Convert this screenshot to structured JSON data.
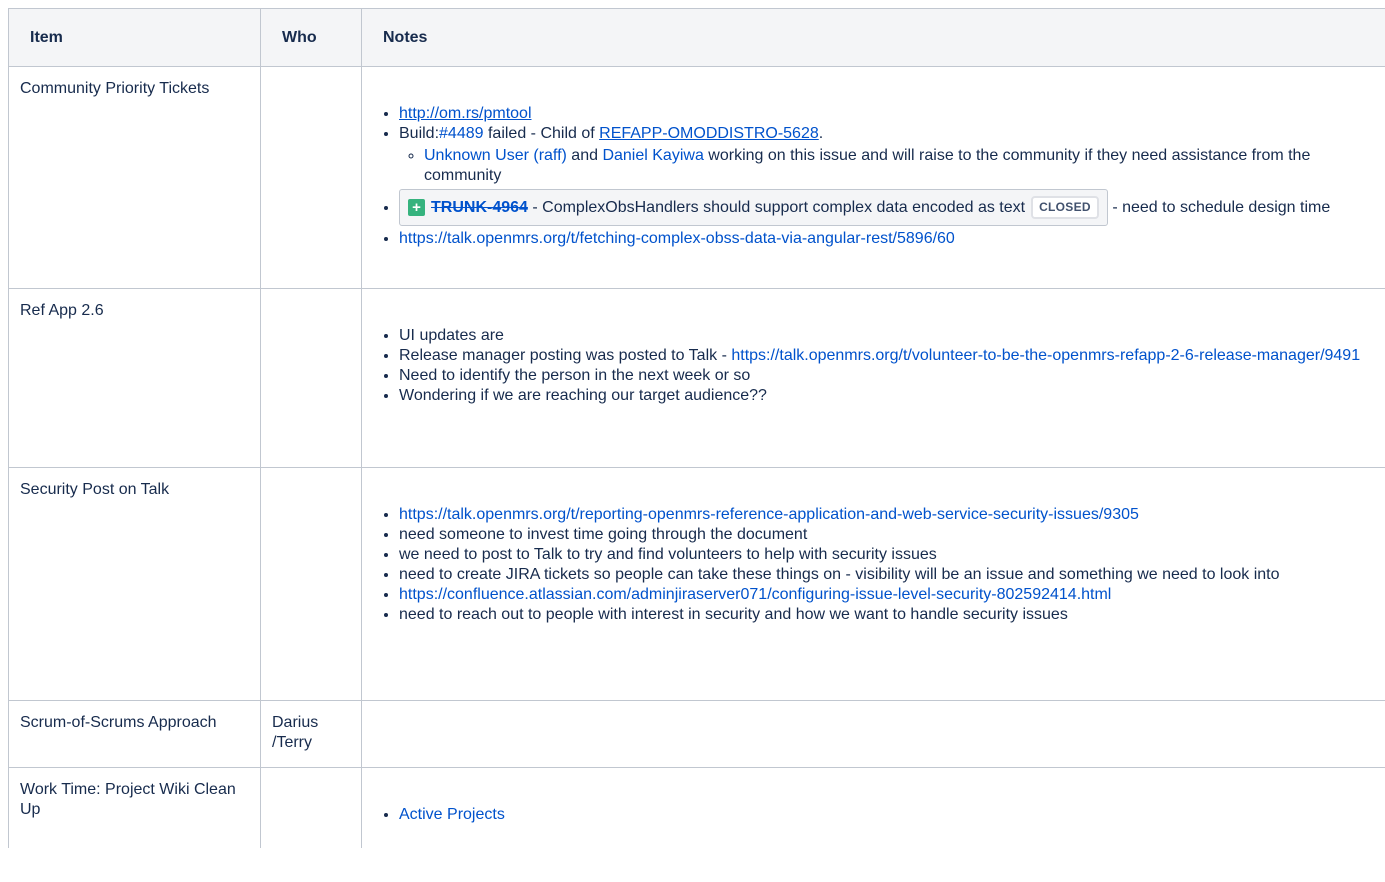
{
  "headers": {
    "item": "Item",
    "who": "Who",
    "notes": "Notes"
  },
  "row1": {
    "item": "Community Priority Tickets",
    "link1": "http://om.rs/pmtool",
    "build_prefix": "Build:",
    "build_link": "#4489",
    "build_mid": " failed - Child of ",
    "build_ticket": "REFAPP-OMODDISTRO-5628",
    "build_end": ".",
    "user1": "Unknown User (raff)",
    "and": " and ",
    "user2": "Daniel Kayiwa",
    "sub_text": " working on this issue and will raise to the community if they need assistance from the community",
    "jira_key": "TRUNK-4964",
    "jira_summary": " - ComplexObsHandlers should support complex data encoded as text ",
    "jira_status": "CLOSED",
    "jira_after": " - need to schedule design time",
    "link2": "https://talk.openmrs.org/t/fetching-complex-obss-data-via-angular-rest/5896/60"
  },
  "row2": {
    "item": "Ref App 2.6",
    "b1": "UI updates are",
    "b2_text": "Release manager posting was posted to Talk - ",
    "b2_link": "https://talk.openmrs.org/t/volunteer-to-be-the-openmrs-refapp-2-6-release-manager/9491",
    "b3": "Need to identify the person in the next week or so",
    "b4": "Wondering if we are reaching our target audience??"
  },
  "row3": {
    "item": "Security Post on Talk",
    "link1": "https://talk.openmrs.org/t/reporting-openmrs-reference-application-and-web-service-security-issues/9305",
    "b2": "need someone to invest time going through the document",
    "b3": "we need to post to Talk to try and find volunteers to help with security issues",
    "b4": "need to create JIRA tickets so people can take these things on - visibility will be an issue and something we need to look into",
    "link2": "https://confluence.atlassian.com/adminjiraserver071/configuring-issue-level-security-802592414.html",
    "b6": "need to reach out to people with interest in security and how we want to handle security issues"
  },
  "row4": {
    "item": "Scrum-of-Scrums Approach",
    "who": "Darius /Terry"
  },
  "row5": {
    "item": "Work Time: Project Wiki Clean Up",
    "link1": "Active Projects"
  }
}
